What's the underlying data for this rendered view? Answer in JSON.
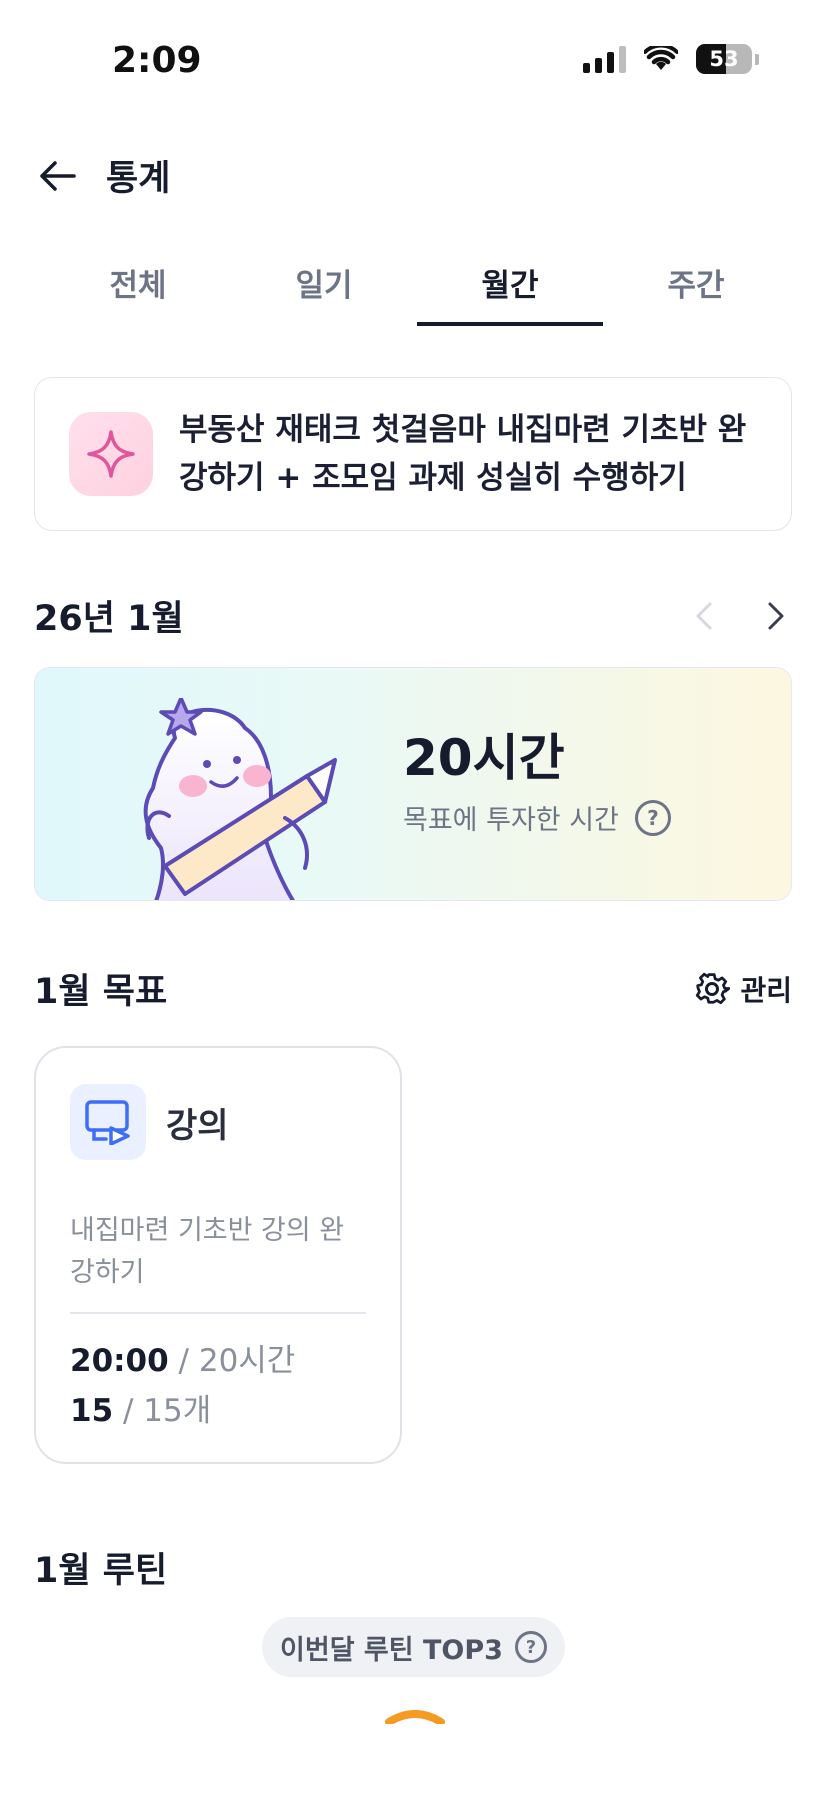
{
  "status": {
    "time": "2:09",
    "battery": "53"
  },
  "header": {
    "title": "통계"
  },
  "tabs": [
    {
      "label": "전체"
    },
    {
      "label": "일기"
    },
    {
      "label": "월간"
    },
    {
      "label": "주간"
    }
  ],
  "active_tab": "월간",
  "goal_banner": {
    "line1": "부동산 재태크 첫걸음마 내집마련 기초반 완",
    "line2": "강하기 + 조모임 과제 성실히 수행하기"
  },
  "month": {
    "label": "26년 1월"
  },
  "time_card": {
    "value": "20시간",
    "subtitle": "목표에 투자한 시간",
    "help": "?"
  },
  "monthly_goals": {
    "title": "1월 목표",
    "manage_label": "관리",
    "card": {
      "title": "강의",
      "desc_line1": "내집마련 기초반 강의 완",
      "desc_line2": "강하기",
      "time_done": "20:00",
      "time_total": " / 20시간",
      "count_done": "15",
      "count_total": " / 15개"
    }
  },
  "routine": {
    "title": "1월 루틴",
    "top3_label": "이번달 루틴 TOP3",
    "help": "?"
  },
  "colors": {
    "accent": "#161b2e",
    "muted": "#8a8f9c",
    "icon_pink": "#e0569b",
    "icon_blue": "#3d6ef5",
    "mascot_stroke": "#5a4bb5",
    "arc_orange": "#f59a23"
  }
}
